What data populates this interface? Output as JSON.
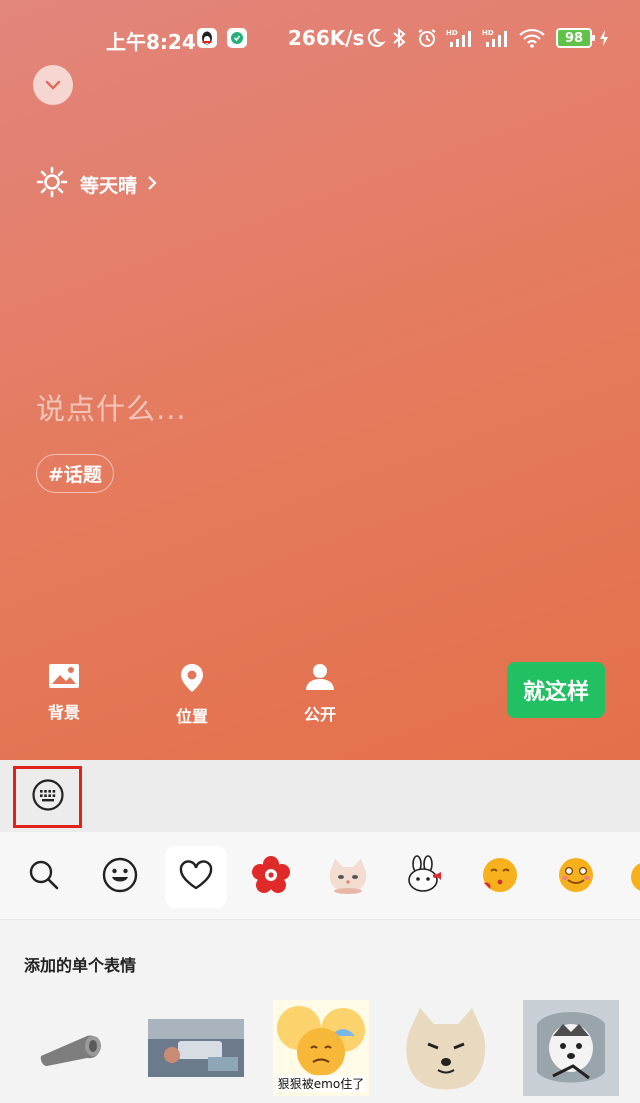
{
  "status_bar": {
    "time": "上午8:24",
    "network_speed": "266K/s",
    "battery_level": "98",
    "icons": [
      "qq-icon",
      "shield-app-icon",
      "moon-icon",
      "bluetooth-icon",
      "alarm-icon",
      "hd-signal-icon",
      "hd-signal-icon",
      "wifi-icon",
      "battery-icon",
      "charging-icon"
    ]
  },
  "header": {
    "collapse_icon": "chevron-down-icon"
  },
  "weather": {
    "label": "等天晴",
    "icon": "sun-icon"
  },
  "composer": {
    "placeholder": "说点什么...",
    "topic_chip": "#话题"
  },
  "toolbar": {
    "background_label": "背景",
    "location_label": "位置",
    "visibility_label": "公开",
    "confirm_label": "就这样"
  },
  "emoji_panel": {
    "tabs": [
      "search-icon",
      "smiley-icon",
      "heart-icon",
      "red-flower-sticker",
      "cat-sticker",
      "rabbit-sticker",
      "kiss-emoji",
      "blush-emoji"
    ],
    "active_tab": "heart-icon",
    "section_title": "添加的单个表情",
    "sticker_caption": "狠狠被emo住了"
  },
  "colors": {
    "hero_top": "#e2857c",
    "hero_bottom": "#e4704a",
    "confirm_green": "#21c062",
    "highlight_red": "#e0221b"
  }
}
